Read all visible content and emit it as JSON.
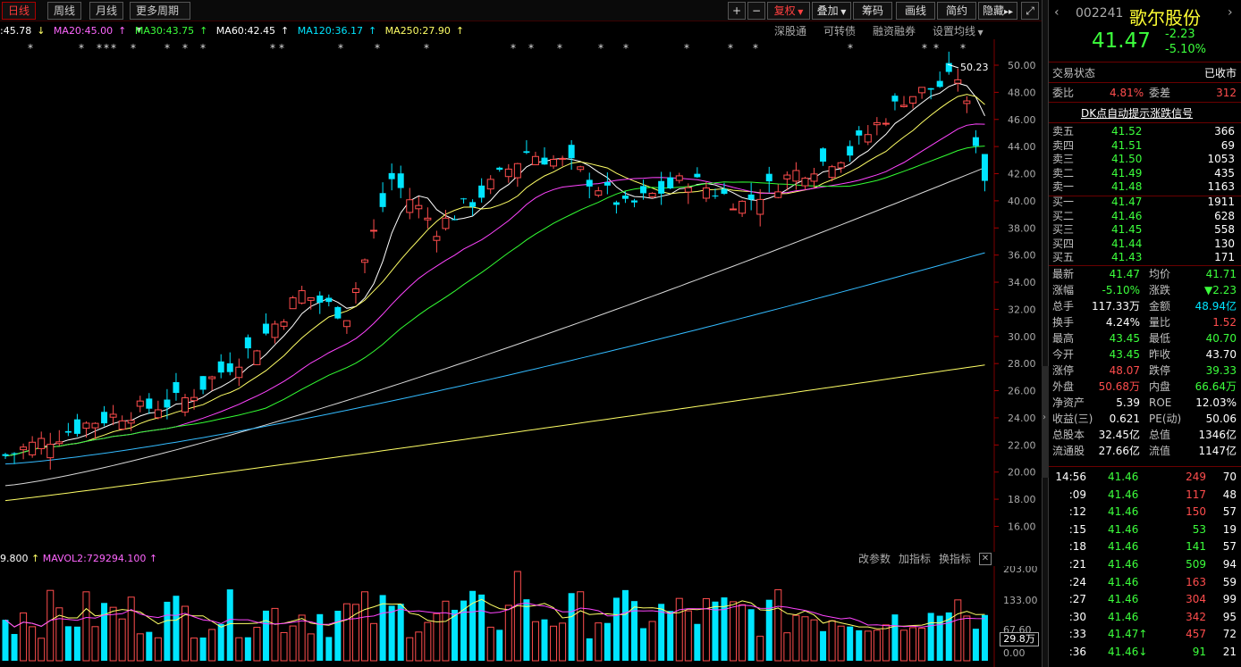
{
  "toolbar": {
    "tabs": [
      "日线",
      "周线",
      "月线",
      "更多周期"
    ],
    "zoom_plus": "+",
    "zoom_minus": "−",
    "fuquan": "复权",
    "diejia": "叠加",
    "chouma": "筹码",
    "huaxian": "画线",
    "jianjie": "简约",
    "yincang": "隐藏"
  },
  "ma_line": {
    "ma_first": ":45.78",
    "ma20": "MA20:45.00",
    "ma30": "MA30:43.75",
    "ma60": "MA60:42.45",
    "ma120": "MA120:36.17",
    "ma250": "MA250:27.90"
  },
  "chart_links": [
    "深股通",
    "可转债",
    "融资融券",
    "设置均线"
  ],
  "price_axis": [
    "50.00",
    "48.00",
    "46.00",
    "44.00",
    "42.00",
    "40.00",
    "38.00",
    "36.00",
    "34.00",
    "32.00",
    "30.00",
    "28.00",
    "26.00",
    "24.00",
    "22.00",
    "20.00",
    "18.00",
    "16.00"
  ],
  "high_marker": "50.23",
  "volume_head": {
    "mavol1": "9.800",
    "mavol2": "MAVOL2:729294.100"
  },
  "volume_links": [
    "改参数",
    "加指标",
    "换指标"
  ],
  "volume_axis": [
    "203.00",
    "133.00",
    "67.60",
    "0.00"
  ],
  "volume_current": "29.8万",
  "colors": {
    "up": "#ff4d4d",
    "down": "#00e5ff",
    "ma5": "#ffffff",
    "ma10": "#ffff66",
    "ma20": "#ff44ff",
    "ma30": "#33ff33",
    "ma60": "#d8d8d8",
    "ma120": "#33bbff",
    "ma250": "#ffff66"
  },
  "stock": {
    "code": "002241",
    "name": "歌尔股份",
    "price": "41.47",
    "change": "-2.23",
    "change_pct": "-5.10%"
  },
  "status": {
    "label": "交易状态",
    "value": "已收市"
  },
  "weibi": {
    "label": "委比",
    "value": "4.81%",
    "label2": "委差",
    "value2": "312"
  },
  "dk_title": "DK点自动提示涨跌信号",
  "asks": [
    {
      "label": "卖五",
      "price": "41.52",
      "vol": "366"
    },
    {
      "label": "卖四",
      "price": "41.51",
      "vol": "69"
    },
    {
      "label": "卖三",
      "price": "41.50",
      "vol": "1053"
    },
    {
      "label": "卖二",
      "price": "41.49",
      "vol": "435"
    },
    {
      "label": "卖一",
      "price": "41.48",
      "vol": "1163"
    }
  ],
  "bids": [
    {
      "label": "买一",
      "price": "41.47",
      "vol": "1911"
    },
    {
      "label": "买二",
      "price": "41.46",
      "vol": "628"
    },
    {
      "label": "买三",
      "price": "41.45",
      "vol": "558"
    },
    {
      "label": "买四",
      "price": "41.44",
      "vol": "130"
    },
    {
      "label": "买五",
      "price": "41.43",
      "vol": "171"
    }
  ],
  "stats": [
    {
      "l1": "最新",
      "v1": "41.47",
      "c1": "green",
      "l2": "均价",
      "v2": "41.71",
      "c2": "green"
    },
    {
      "l1": "涨幅",
      "v1": "-5.10%",
      "c1": "green",
      "l2": "涨跌",
      "v2": "▼2.23",
      "c2": "green"
    },
    {
      "l1": "总手",
      "v1": "117.33万",
      "c1": "white",
      "l2": "金额",
      "v2": "48.94亿",
      "c2": "cyan"
    },
    {
      "l1": "换手",
      "v1": "4.24%",
      "c1": "white",
      "l2": "量比",
      "v2": "1.52",
      "c2": "red"
    },
    {
      "l1": "最高",
      "v1": "43.45",
      "c1": "green",
      "l2": "最低",
      "v2": "40.70",
      "c2": "green"
    },
    {
      "l1": "今开",
      "v1": "43.45",
      "c1": "green",
      "l2": "昨收",
      "v2": "43.70",
      "c2": "white"
    },
    {
      "l1": "涨停",
      "v1": "48.07",
      "c1": "red",
      "l2": "跌停",
      "v2": "39.33",
      "c2": "green"
    },
    {
      "l1": "外盘",
      "v1": "50.68万",
      "c1": "red",
      "l2": "内盘",
      "v2": "66.64万",
      "c2": "green"
    },
    {
      "l1": "净资产",
      "v1": "5.39",
      "c1": "white",
      "l2": "ROE",
      "v2": "12.03%",
      "c2": "white"
    },
    {
      "l1": "收益(三)",
      "v1": "0.621",
      "c1": "white",
      "l2": "PE(动)",
      "v2": "50.06",
      "c2": "white"
    },
    {
      "l1": "总股本",
      "v1": "32.45亿",
      "c1": "white",
      "l2": "总值",
      "v2": "1346亿",
      "c2": "white"
    },
    {
      "l1": "流通股",
      "v1": "27.66亿",
      "c1": "white",
      "l2": "流值",
      "v2": "1147亿",
      "c2": "white"
    }
  ],
  "ticks": [
    {
      "time": "14:56",
      "price": "41.46",
      "vol": "249",
      "n": "70",
      "vc": "red"
    },
    {
      "time": ":09",
      "price": "41.46",
      "vol": "117",
      "n": "48",
      "vc": "red"
    },
    {
      "time": ":12",
      "price": "41.46",
      "vol": "150",
      "n": "57",
      "vc": "red"
    },
    {
      "time": ":15",
      "price": "41.46",
      "vol": "53",
      "n": "19",
      "vc": "green"
    },
    {
      "time": ":18",
      "price": "41.46",
      "vol": "141",
      "n": "57",
      "vc": "green"
    },
    {
      "time": ":21",
      "price": "41.46",
      "vol": "509",
      "n": "94",
      "vc": "green"
    },
    {
      "time": ":24",
      "price": "41.46",
      "vol": "163",
      "n": "59",
      "vc": "red"
    },
    {
      "time": ":27",
      "price": "41.46",
      "vol": "304",
      "n": "99",
      "vc": "red"
    },
    {
      "time": ":30",
      "price": "41.46",
      "vol": "342",
      "n": "95",
      "vc": "red"
    },
    {
      "time": ":33",
      "price": "41.47↑",
      "vol": "457",
      "n": "72",
      "vc": "red"
    },
    {
      "time": ":36",
      "price": "41.46↓",
      "vol": "91",
      "n": "21",
      "vc": "green"
    }
  ]
}
